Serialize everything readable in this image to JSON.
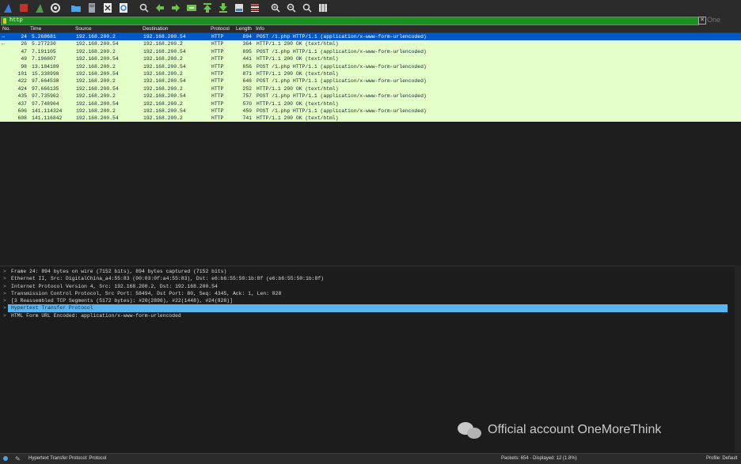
{
  "colors": {
    "row_bg": "#e4ffc7",
    "row_selected_bg": "#0059c9",
    "filter_bg": "#1f8f1f",
    "detail_selected_bg": "#5ab4f0"
  },
  "toolbar": {
    "icons": [
      "shark-fin-start-icon",
      "stop-square-icon",
      "restart-fin-icon",
      "options-gear-icon",
      "open-folder-icon",
      "save-file-icon",
      "close-file-icon",
      "reload-file-icon",
      "find-magnifier-icon",
      "go-back-arrow-icon",
      "go-forward-arrow-icon",
      "go-to-packet-icon",
      "first-packet-icon",
      "last-packet-icon",
      "autoscroll-icon",
      "colorize-icon",
      "zoom-in-icon",
      "zoom-out-icon",
      "zoom-normal-icon",
      "resize-columns-icon"
    ]
  },
  "filter": {
    "value": "http",
    "apply_label": "One"
  },
  "packet_list": {
    "headers": {
      "no": "No.",
      "time": "Time",
      "source": "Source",
      "destination": "Destination",
      "protocol": "Protocol",
      "length": "Length",
      "info": "Info"
    },
    "rows": [
      {
        "mark": "→",
        "no": "24",
        "time": "5.268681",
        "source": "192.168.200.2",
        "destination": "192.168.200.54",
        "protocol": "HTTP",
        "length": "894",
        "info": "POST /1.php HTTP/1.1  (application/x-www-form-urlencoded)"
      },
      {
        "mark": "←",
        "no": "26",
        "time": "5.277230",
        "source": "192.168.200.54",
        "destination": "192.168.200.2",
        "protocol": "HTTP",
        "length": "364",
        "info": "HTTP/1.1 200 OK  (text/html)"
      },
      {
        "mark": "",
        "no": "47",
        "time": "7.191105",
        "source": "192.168.200.2",
        "destination": "192.168.200.54",
        "protocol": "HTTP",
        "length": "895",
        "info": "POST /1.php HTTP/1.1  (application/x-www-form-urlencoded)"
      },
      {
        "mark": "",
        "no": "49",
        "time": "7.196807",
        "source": "192.168.200.54",
        "destination": "192.168.200.2",
        "protocol": "HTTP",
        "length": "441",
        "info": "HTTP/1.1 200 OK  (text/html)"
      },
      {
        "mark": "",
        "no": "98",
        "time": "13.184189",
        "source": "192.168.200.2",
        "destination": "192.168.200.54",
        "protocol": "HTTP",
        "length": "856",
        "info": "POST /1.php HTTP/1.1  (application/x-www-form-urlencoded)"
      },
      {
        "mark": "",
        "no": "101",
        "time": "15.338998",
        "source": "192.168.200.54",
        "destination": "192.168.200.2",
        "protocol": "HTTP",
        "length": "871",
        "info": "HTTP/1.1 200 OK  (text/html)"
      },
      {
        "mark": "",
        "no": "422",
        "time": "97.664538",
        "source": "192.168.200.2",
        "destination": "192.168.200.54",
        "protocol": "HTTP",
        "length": "646",
        "info": "POST /1.php HTTP/1.1  (application/x-www-form-urlencoded)"
      },
      {
        "mark": "",
        "no": "424",
        "time": "97.666135",
        "source": "192.168.200.54",
        "destination": "192.168.200.2",
        "protocol": "HTTP",
        "length": "252",
        "info": "HTTP/1.1 200 OK  (text/html)"
      },
      {
        "mark": "",
        "no": "435",
        "time": "97.735962",
        "source": "192.168.200.2",
        "destination": "192.168.200.54",
        "protocol": "HTTP",
        "length": "757",
        "info": "POST /1.php HTTP/1.1  (application/x-www-form-urlencoded)"
      },
      {
        "mark": "",
        "no": "437",
        "time": "97.748964",
        "source": "192.168.200.54",
        "destination": "192.168.200.2",
        "protocol": "HTTP",
        "length": "570",
        "info": "HTTP/1.1 200 OK  (text/html)"
      },
      {
        "mark": "",
        "no": "606",
        "time": "141.114324",
        "source": "192.168.200.2",
        "destination": "192.168.200.54",
        "protocol": "HTTP",
        "length": "459",
        "info": "POST /1.php HTTP/1.1  (application/x-www-form-urlencoded)"
      },
      {
        "mark": "",
        "no": "608",
        "time": "141.116842",
        "source": "192.168.200.54",
        "destination": "192.168.200.2",
        "protocol": "HTTP",
        "length": "741",
        "info": "HTTP/1.1 200 OK  (text/html)"
      }
    ]
  },
  "details": {
    "rows": [
      {
        "arrow": ">",
        "text": "Frame 24: 894 bytes on wire (7152 bits), 894 bytes captured (7152 bits)"
      },
      {
        "arrow": ">",
        "text": "Ethernet II, Src: DigitalChina_a4:55:83 (00:03:0f:a4:55:83), Dst: e6:b6:55:50:1b:8f (e6:b6:55:50:1b:8f)"
      },
      {
        "arrow": ">",
        "text": "Internet Protocol Version 4, Src: 192.168.200.2, Dst: 192.168.200.54"
      },
      {
        "arrow": ">",
        "text": "Transmission Control Protocol, Src Port: 58494, Dst Port: 80, Seq: 4345, Ack: 1, Len: 828"
      },
      {
        "arrow": ">",
        "text": "[3 Reassembled TCP Segments (5172 bytes): #20(2896), #22(1448), #24(828)]"
      },
      {
        "arrow": ">",
        "text": "Hypertext Transfer Protocol"
      },
      {
        "arrow": ">",
        "text": "HTML Form URL Encoded: application/x-www-form-urlencoded"
      }
    ]
  },
  "watermark": {
    "text": "Official account OneMoreThink"
  },
  "statusbar": {
    "field": "Hypertext Transfer Protocol: Protocol",
    "packets": "Packets: 654 · Displayed: 12 (1.8%)",
    "profile": "Profile: Default"
  }
}
